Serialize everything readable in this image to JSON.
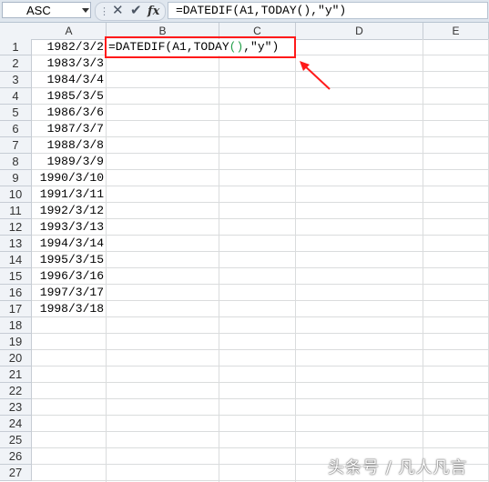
{
  "formula_bar": {
    "name_box": "ASC",
    "formula": "=DATEDIF(A1,TODAY(),\"y\")"
  },
  "columns": [
    "A",
    "B",
    "C",
    "D",
    "E"
  ],
  "rows": [
    "1",
    "2",
    "3",
    "4",
    "5",
    "6",
    "7",
    "8",
    "9",
    "10",
    "11",
    "12",
    "13",
    "14",
    "15",
    "16",
    "17",
    "18",
    "19",
    "20",
    "21",
    "22",
    "23",
    "24",
    "25",
    "26",
    "27"
  ],
  "column_a_values": [
    "1982/3/2",
    "1983/3/3",
    "1984/3/4",
    "1985/3/5",
    "1986/3/6",
    "1987/3/7",
    "1988/3/8",
    "1989/3/9",
    "1990/3/10",
    "1991/3/11",
    "1992/3/12",
    "1993/3/13",
    "1994/3/14",
    "1995/3/15",
    "1996/3/16",
    "1997/3/17",
    "1998/3/18"
  ],
  "edit_cell": {
    "part1": "=DATEDIF(A1,TODAY",
    "paren_open": "(",
    "paren_close": ")",
    "part2": ",\"y\")"
  },
  "annotation": {
    "color": "#ff1a1a"
  },
  "watermark": "头条号 / 凡人凡言"
}
